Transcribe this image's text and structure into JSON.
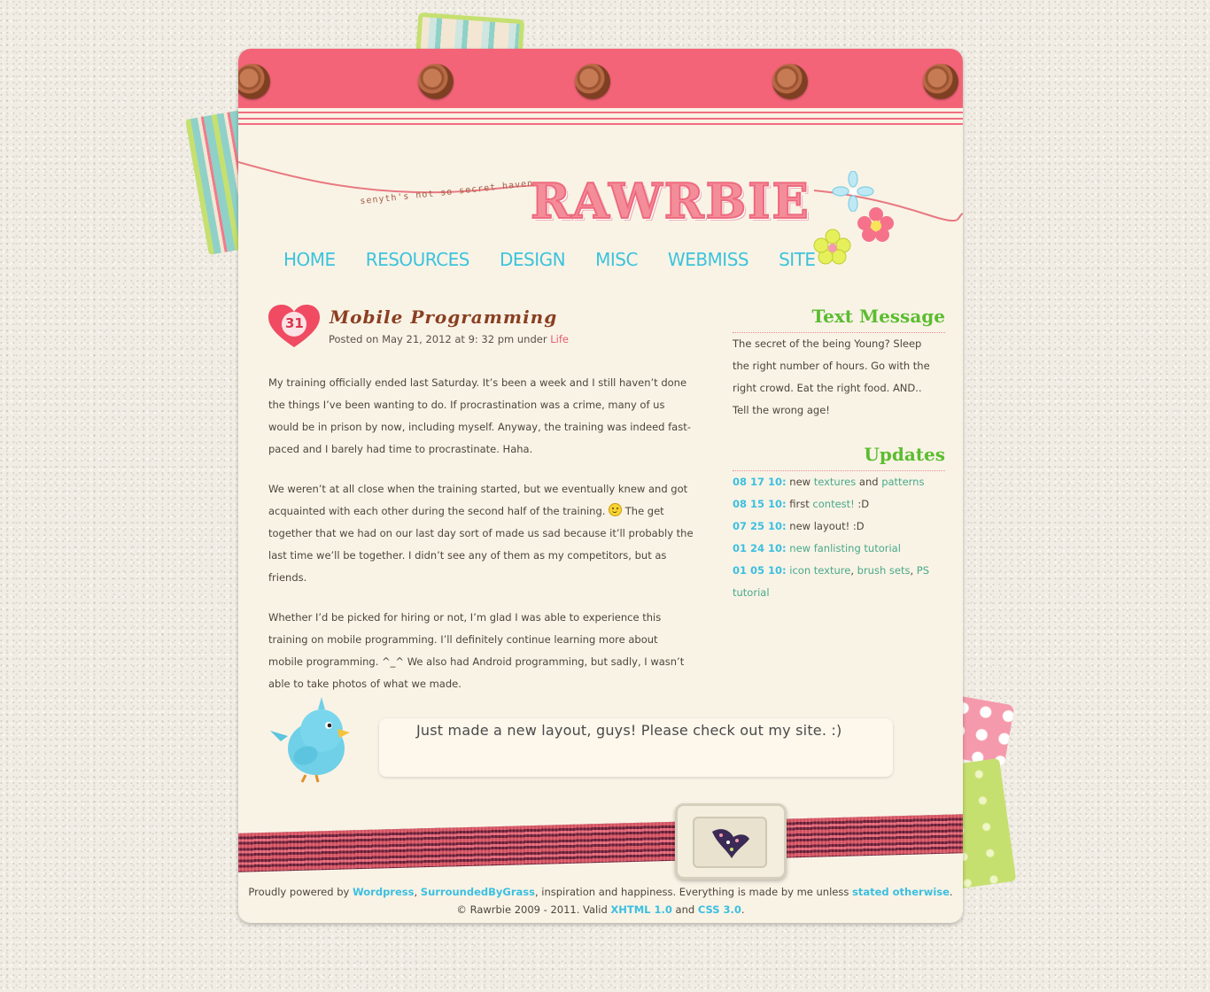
{
  "site": {
    "title": "RAWRBIE",
    "tagline": "senyth's not so secret haven"
  },
  "nav": {
    "items": [
      {
        "label": "HOME"
      },
      {
        "label": "RESOURCES"
      },
      {
        "label": "DESIGN"
      },
      {
        "label": "MISC"
      },
      {
        "label": "WEBMISS"
      },
      {
        "label": "SITE"
      }
    ]
  },
  "post": {
    "day": "31",
    "title": "Mobile Programming",
    "meta_prefix": "Posted on May 21, 2012 at 9: 32 pm under",
    "category": "Life",
    "paragraphs": {
      "p1": "My training officially ended last Saturday. It’s been a week and I still haven’t done the things I’ve been wanting to do. If procrastination was a crime, many of us would be in prison by now, including myself. Anyway, the training was indeed fast-paced and I barely had time to procrastinate. Haha.",
      "p2_a": "We weren’t at all close when the training started, but we eventually knew and got acquainted with each other during the second half of the training.",
      "p2_b": "The get together that we had on our last day sort of made us sad because it’ll probably the last time we’ll be together. I didn’t see any of them as my competitors, but as friends.",
      "p3": "Whether I’d be picked for hiring or not, I’m glad I was able to experience this training on mobile programming. I’ll definitely continue learning more about mobile programming. ^_^ We also had Android programming, but sadly, I wasn’t able to take photos of what we made."
    }
  },
  "sidebar": {
    "text_message": {
      "title": "Text Message",
      "body": "The secret of the being Young? Sleep the right number of hours. Go with the right crowd. Eat the right food. AND.. Tell the wrong age!"
    },
    "updates": {
      "title": "Updates",
      "items": [
        {
          "date": "08 17 10:",
          "t1": "new",
          "l1": "textures",
          "t2": "and",
          "l2": "patterns"
        },
        {
          "date": "08 15 10:",
          "t1": "first",
          "l1": "contest!",
          "t2": ":D"
        },
        {
          "date": "07 25 10:",
          "t1": "new layout! :D"
        },
        {
          "date": "01 24 10:",
          "l1": "new fanlisting tutorial"
        },
        {
          "date": "01 05 10:",
          "l1": "icon texture",
          "sep1": ",",
          "l2": "brush sets",
          "sep2": ",",
          "l3": "PS tutorial"
        }
      ]
    }
  },
  "shoutout": {
    "text": "Just made a new layout, guys! Please check out my site. :)"
  },
  "footer": {
    "line1_a": "Proudly powered by",
    "link_wordpress": "Wordpress",
    "comma1": ",",
    "link_sbg": "SurroundedByGrass",
    "line1_b": ", inspiration and happiness. Everything is made by me unless",
    "link_stated": "stated otherwise",
    "period": ".",
    "line2_a": "© Rawrbie 2009 - 2011. Valid",
    "link_xhtml": "XHTML 1.0",
    "and": "and",
    "link_css": "CSS 3.0",
    "period2": "."
  },
  "colors": {
    "accent_pink": "#f46478",
    "nav_blue": "#3cc3dc",
    "sidebar_green": "#5bbd2f",
    "link_teal": "#48a98a"
  }
}
